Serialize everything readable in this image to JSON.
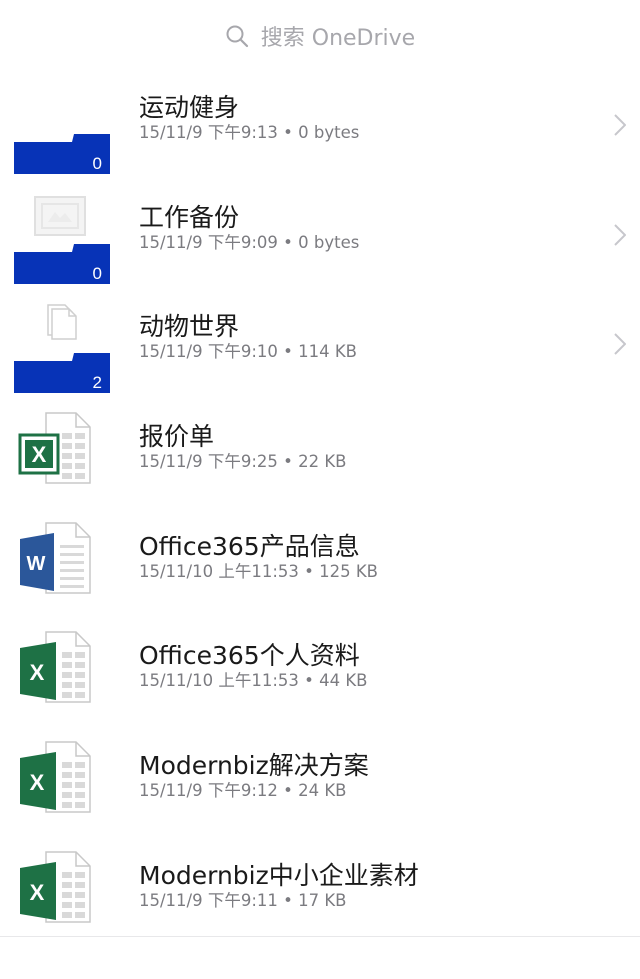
{
  "search": {
    "placeholder": "搜索 OneDrive",
    "icon": "search-icon"
  },
  "colors": {
    "folder_blue": "#0733b7",
    "excel_green": "#1e7145",
    "word_blue": "#2b579a",
    "meta_gray": "#7b7b80"
  },
  "items": [
    {
      "name": "运动健身",
      "meta": "15/11/9 下午9:13 • 0 bytes",
      "kind": "folder",
      "count": "0",
      "preview": "none"
    },
    {
      "name": "工作备份",
      "meta": "15/11/9 下午9:09 • 0 bytes",
      "kind": "folder",
      "count": "0",
      "preview": "image"
    },
    {
      "name": "动物世界",
      "meta": "15/11/9 下午9:10 • 114 KB",
      "kind": "folder",
      "count": "2",
      "preview": "document"
    },
    {
      "name": "报价单",
      "meta": "15/11/9 下午9:25 • 22 KB",
      "kind": "excel-old"
    },
    {
      "name": "Office365产品信息",
      "meta": "15/11/10 上午11:53 • 125 KB",
      "kind": "word"
    },
    {
      "name": "Office365个人资料",
      "meta": "15/11/10 上午11:53 • 44 KB",
      "kind": "excel"
    },
    {
      "name": "Modernbiz解决方案",
      "meta": "15/11/9 下午9:12 • 24 KB",
      "kind": "excel"
    },
    {
      "name": "Modernbiz中小企业素材",
      "meta": "15/11/9 下午9:11 • 17 KB",
      "kind": "excel"
    }
  ]
}
